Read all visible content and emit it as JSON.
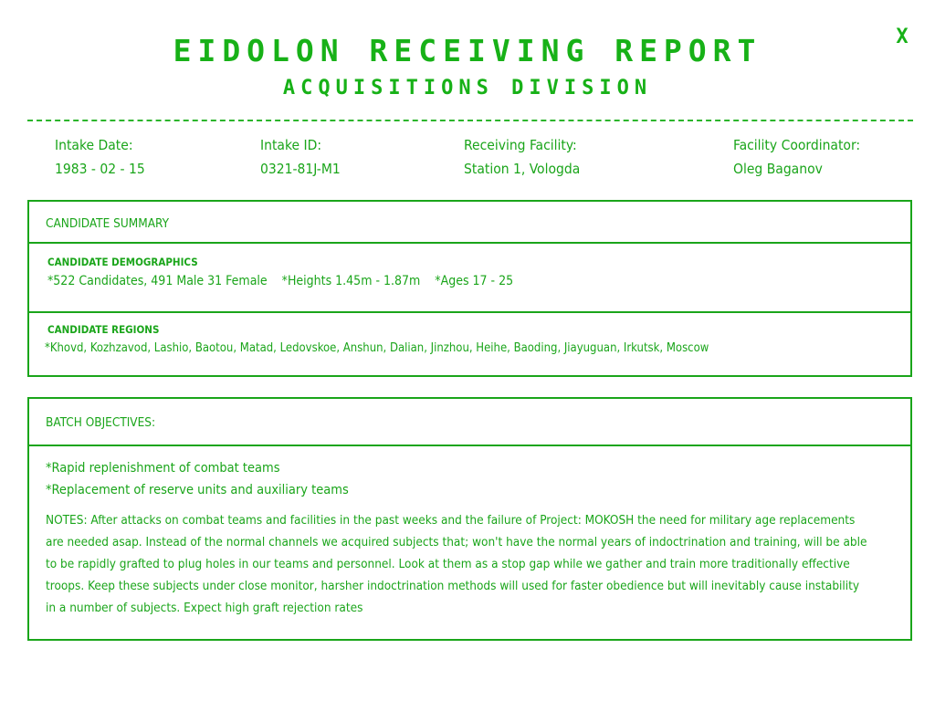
{
  "report": {
    "title": "EIDOLON RECEIVING REPORT",
    "subtitle": "ACQUISITIONS DIVISION",
    "close_label": "X"
  },
  "intake": [
    {
      "label": "Intake Date:",
      "value": "1983 - 02 - 15"
    },
    {
      "label": "Intake ID:",
      "value": "0321-81J-M1"
    },
    {
      "label": "Receiving Facility:",
      "value": "Station 1, Vologda"
    },
    {
      "label": "Facility Coordinator:",
      "value": "Oleg Baganov"
    }
  ],
  "candidate_summary": {
    "header": "CANDIDATE SUMMARY",
    "demographics_title": "CANDIDATE DEMOGRAPHICS",
    "demographics_text": "*522 Candidates, 491 Male 31 Female    *Heights 1.45m - 1.87m    *Ages 17 - 25",
    "regions_title": "CANDIDATE REGIONS",
    "regions_text": "*Khovd, Kozhzavod, Lashio, Baotou, Matad, Ledovskoe, Anshun, Dalian, Jinzhou, Heihe, Baoding, Jiayuguan, Irkutsk, Moscow"
  },
  "batch_objectives": {
    "header": "BATCH OBJECTIVES:",
    "items": [
      "*Rapid replenishment of combat teams",
      "*Replacement of reserve units and auxiliary teams"
    ],
    "notes": "NOTES: After attacks on combat teams and facilities in the past weeks and the failure of Project: MOKOSH the need for military age replacements are needed asap. Instead of the normal channels we acquired subjects that; won't have the normal years of indoctrination and training, will be able to be rapidly grafted to plug holes in our teams and personnel. Look at them as a stop gap while we gather and train more traditionally effective troops. Keep these subjects under close monitor, harsher indoctrination methods will used for faster obedience but will inevitably cause instability in a number of subjects. Expect high graft rejection rates"
  }
}
